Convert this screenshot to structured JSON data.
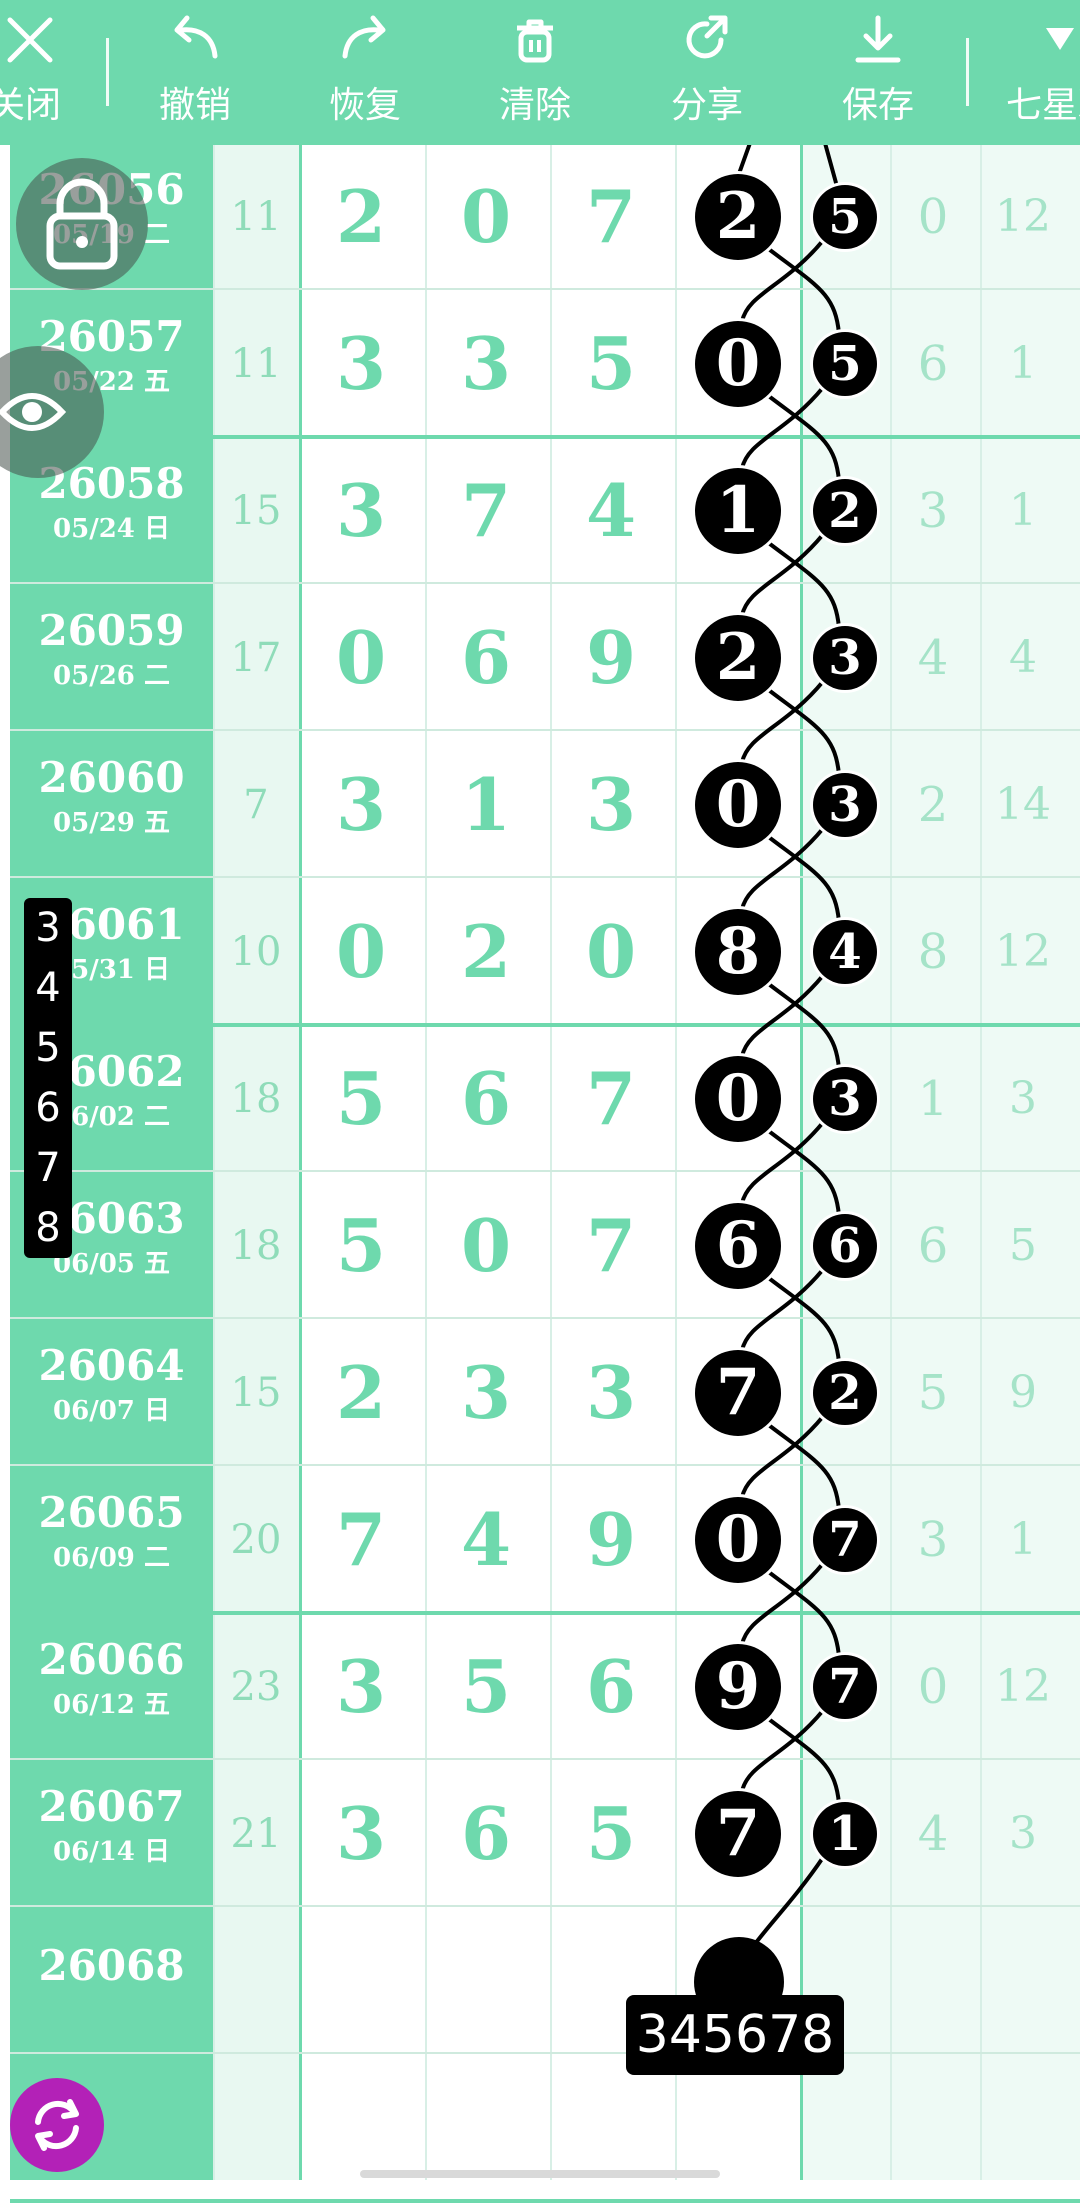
{
  "toolbar": {
    "close": "关闭",
    "undo": "撤销",
    "redo": "恢复",
    "clear": "清除",
    "share": "分享",
    "save": "保存",
    "lottery": "七星彩"
  },
  "rows": [
    {
      "id": "26056",
      "date": "05/19 二",
      "sum": "11",
      "d1": "2",
      "d2": "0",
      "d3": "7",
      "ball": "2",
      "small": "5",
      "r1": "0",
      "r2": "12"
    },
    {
      "id": "26057",
      "date": "05/22 五",
      "sum": "11",
      "d1": "3",
      "d2": "3",
      "d3": "5",
      "ball": "0",
      "small": "5",
      "r1": "6",
      "r2": "1"
    },
    {
      "id": "26058",
      "date": "05/24 日",
      "sum": "15",
      "d1": "3",
      "d2": "7",
      "d3": "4",
      "ball": "1",
      "small": "2",
      "r1": "3",
      "r2": "1"
    },
    {
      "id": "26059",
      "date": "05/26 二",
      "sum": "17",
      "d1": "0",
      "d2": "6",
      "d3": "9",
      "ball": "2",
      "small": "3",
      "r1": "4",
      "r2": "4"
    },
    {
      "id": "26060",
      "date": "05/29 五",
      "sum": "7",
      "d1": "3",
      "d2": "1",
      "d3": "3",
      "ball": "0",
      "small": "3",
      "r1": "2",
      "r2": "14"
    },
    {
      "id": "26061",
      "date": "05/31 日",
      "sum": "10",
      "d1": "0",
      "d2": "2",
      "d3": "0",
      "ball": "8",
      "small": "4",
      "r1": "8",
      "r2": "12"
    },
    {
      "id": "26062",
      "date": "06/02 二",
      "sum": "18",
      "d1": "5",
      "d2": "6",
      "d3": "7",
      "ball": "0",
      "small": "3",
      "r1": "1",
      "r2": "3"
    },
    {
      "id": "26063",
      "date": "06/05 五",
      "sum": "18",
      "d1": "5",
      "d2": "0",
      "d3": "7",
      "ball": "6",
      "small": "6",
      "r1": "6",
      "r2": "5"
    },
    {
      "id": "26064",
      "date": "06/07 日",
      "sum": "15",
      "d1": "2",
      "d2": "3",
      "d3": "3",
      "ball": "7",
      "small": "2",
      "r1": "5",
      "r2": "9"
    },
    {
      "id": "26065",
      "date": "06/09 二",
      "sum": "20",
      "d1": "7",
      "d2": "4",
      "d3": "9",
      "ball": "0",
      "small": "7",
      "r1": "3",
      "r2": "1"
    },
    {
      "id": "26066",
      "date": "06/12 五",
      "sum": "23",
      "d1": "3",
      "d2": "5",
      "d3": "6",
      "ball": "9",
      "small": "7",
      "r1": "0",
      "r2": "12"
    },
    {
      "id": "26067",
      "date": "06/14 日",
      "sum": "21",
      "d1": "3",
      "d2": "6",
      "d3": "5",
      "ball": "7",
      "small": "1",
      "r1": "4",
      "r2": "3"
    }
  ],
  "next_id": "26068",
  "number_strip": [
    "3",
    "4",
    "5",
    "6",
    "7",
    "8"
  ],
  "prediction": "345678",
  "icons": {
    "close": "close-icon",
    "undo": "undo-icon",
    "redo": "redo-icon",
    "clear": "trash-icon",
    "share": "share-icon",
    "save": "download-icon",
    "lottery": "triangle-down-icon",
    "lock": "lock-icon",
    "eye": "eye-icon",
    "refresh": "refresh-icon"
  },
  "colors": {
    "accent": "#6ed9ad",
    "digit": "#6ed9ad",
    "ball": "#000000",
    "refresh": "#b321b7"
  }
}
